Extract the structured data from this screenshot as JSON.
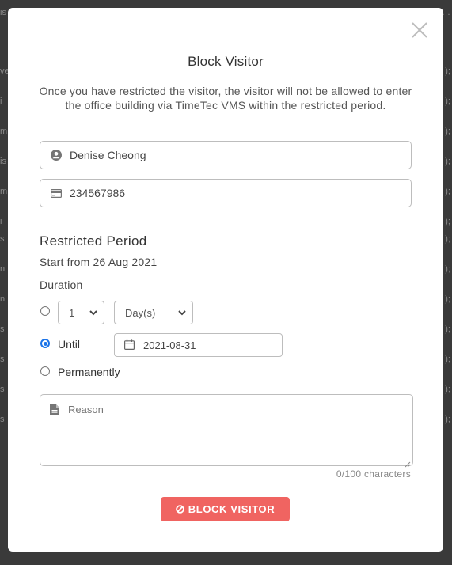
{
  "modal": {
    "title": "Block Visitor",
    "description": "Once you have restricted the visitor, the visitor will not be allowed to enter the office building via TimeTec VMS within the restricted period."
  },
  "visitor": {
    "name": "Denise Cheong",
    "id_number": "234567986"
  },
  "restricted_period": {
    "section_title": "Restricted Period",
    "start_text": "Start from 26 Aug 2021",
    "duration_label": "Duration",
    "duration_value": "1",
    "duration_unit": "Day(s)",
    "until_label": "Until",
    "until_date": "2021-08-31",
    "permanently_label": "Permanently",
    "selected_option": "until"
  },
  "reason": {
    "placeholder": "Reason",
    "counter": "0/100 characters"
  },
  "actions": {
    "block_button": "BLOCK VISITOR"
  },
  "colors": {
    "accent": "#1a73e8",
    "danger": "#f06461"
  }
}
